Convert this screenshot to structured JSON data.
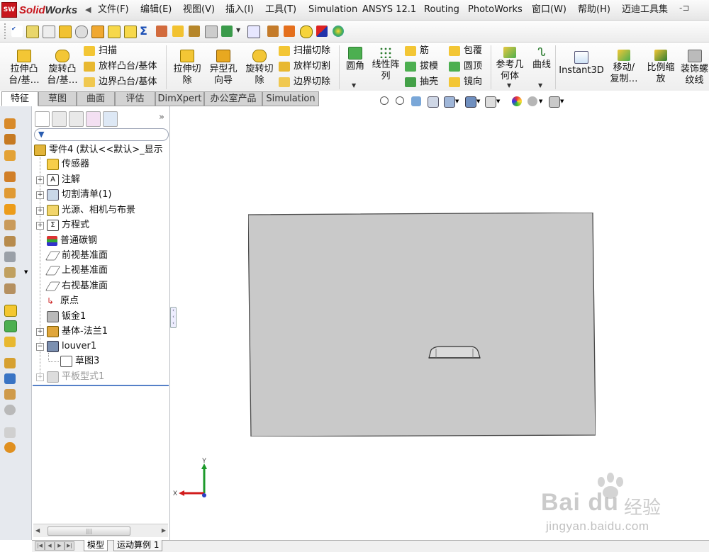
{
  "app": {
    "logo_badge": "SW",
    "logo_solid": "Solid",
    "logo_works": "Works"
  },
  "menu": {
    "items": [
      "文件(F)",
      "编辑(E)",
      "视图(V)",
      "插入(I)",
      "工具(T)",
      "Simulation",
      "ANSYS 12.1",
      "Routing",
      "PhotoWorks",
      "窗口(W)",
      "帮助(H)",
      "迈迪工具集"
    ],
    "pin": "-⊐"
  },
  "commands": {
    "extrude_boss": "拉伸凸\n台/基…",
    "revolve_boss": "旋转凸\n台/基…",
    "sweep": "扫描",
    "loft_boss": "放样凸台/基体",
    "boundary_boss": "边界凸台/基体",
    "extrude_cut": "拉伸切\n除",
    "hole_wizard": "异型孔\n向导",
    "revolve_cut": "旋转切\n除",
    "sweep_cut": "扫描切除",
    "loft_cut": "放样切割",
    "boundary_cut": "边界切除",
    "fillet": "圆角",
    "linear_pattern": "线性阵\n列",
    "rib": "筋",
    "draft": "拔模",
    "shell": "抽壳",
    "wrap": "包覆",
    "dome": "圆顶",
    "mirror": "镜向",
    "ref_geometry": "参考几\n何体",
    "curves": "曲线",
    "instant3d": "Instant3D",
    "move_copy": "移动/\n复制…",
    "scale": "比例缩\n放",
    "cosmetic_thread": "装饰螺\n纹线"
  },
  "tabs": [
    "特征",
    "草图",
    "曲面",
    "评估",
    "DimXpert",
    "办公室产品",
    "Simulation"
  ],
  "active_tab": "特征",
  "feature_tree": {
    "root": "零件4 (默认<<默认>_显示",
    "items": [
      {
        "label": "传感器",
        "expandable": false
      },
      {
        "label": "注解",
        "expandable": true
      },
      {
        "label": "切割清单(1)",
        "expandable": true
      },
      {
        "label": "光源、相机与布景",
        "expandable": true
      },
      {
        "label": "方程式",
        "expandable": true
      },
      {
        "label": "普通碳钢",
        "expandable": false
      },
      {
        "label": "前视基准面",
        "expandable": false
      },
      {
        "label": "上视基准面",
        "expandable": false
      },
      {
        "label": "右视基准面",
        "expandable": false
      },
      {
        "label": "原点",
        "expandable": false
      },
      {
        "label": "钣金1",
        "expandable": false
      },
      {
        "label": "基体-法兰1",
        "expandable": true
      },
      {
        "label": "louver1",
        "expandable": true,
        "expanded": true
      },
      {
        "label": "草图3",
        "expandable": false,
        "child": true
      },
      {
        "label": "平板型式1",
        "expandable": true,
        "suppressed": true
      }
    ],
    "expand_glyph": "»"
  },
  "bottom_tabs": [
    "模型",
    "运动算例 1"
  ],
  "scroll_grip": "|||",
  "triad": {
    "x": "X",
    "y": "Y"
  },
  "watermark": {
    "brand": "Bai du",
    "cn": "经验",
    "url": "jingyan.baidu.com"
  },
  "colors": {
    "plate_fill": "#c9c9c9",
    "plate_edge": "#4a4a4a",
    "triad_x": "#d11c1c",
    "triad_y": "#1d9a2b",
    "triad_z": "#2a3fc4",
    "suppressed_text": "#9a9a9a"
  }
}
